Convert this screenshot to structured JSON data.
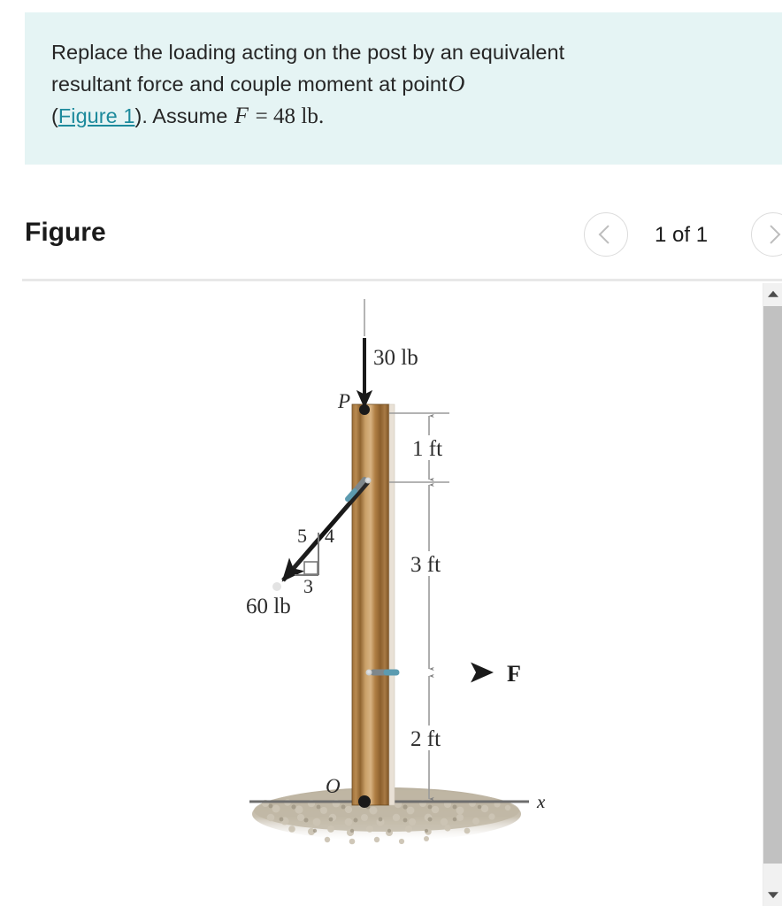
{
  "problem": {
    "line1": "Replace the loading acting on the post by an equivalent",
    "line2_a": "resultant force and couple moment at point",
    "line2_var": "O",
    "line3_open": "(",
    "line3_link": "Figure 1",
    "line3_mid": "). Assume",
    "line3_var": "F",
    "line3_eq": "= 48 lb.",
    "background_color": "#e5f4f4",
    "link_color": "#1d8a9c"
  },
  "figure_header": {
    "title": "Figure",
    "page_count": "1 of 1",
    "prev_icon": "chevron-left-icon",
    "next_icon": "chevron-right-icon"
  },
  "scrollbar": {
    "up_icon": "triangle-up-icon",
    "down_icon": "triangle-down-icon"
  },
  "figure": {
    "labels": {
      "force_top": "30 lb",
      "point_p": "P",
      "point_o": "O",
      "force_incline": "60 lb",
      "force_f": "F",
      "axis_x": "x",
      "dim_1ft": "1 ft",
      "dim_3ft": "3 ft",
      "dim_2ft": "2 ft",
      "slope_hyp": "5",
      "slope_vert": "4",
      "slope_horiz": "3"
    },
    "colors": {
      "wood_light": "#c89b62",
      "wood_mid": "#a9773f",
      "wood_dark": "#7d5526",
      "arrow": "#1a1a1a",
      "dimension_line": "#8c8c8c",
      "gravel": "#b8ae9c"
    }
  }
}
